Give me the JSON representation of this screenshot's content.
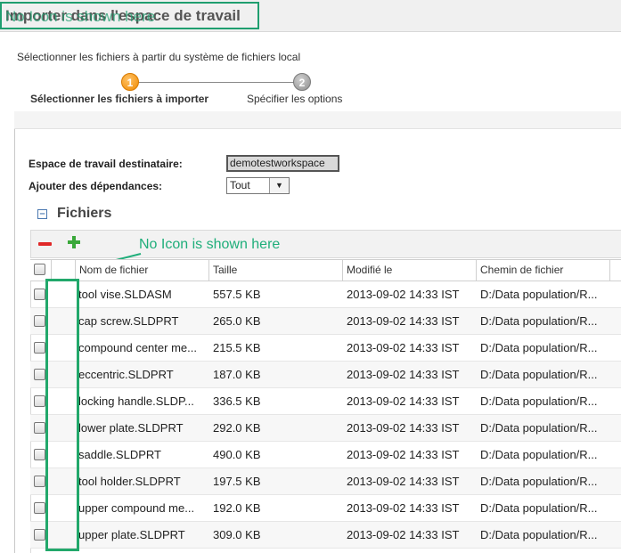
{
  "window": {
    "title": "Importer dans l'espace de travail",
    "title_overlay": "No Icon is shown here"
  },
  "instruction": "Sélectionner les fichiers à partir du système de fichiers local",
  "wizard": {
    "steps": [
      {
        "number": "1",
        "label": "Sélectionner les fichiers à importer",
        "active": true
      },
      {
        "number": "2",
        "label": "Spécifier les options",
        "active": false
      }
    ]
  },
  "form": {
    "workspace_label": "Espace de travail destinataire:",
    "workspace_value": "demotestworkspace",
    "dependencies_label": "Ajouter des dépendances:",
    "dependencies_value": "Tout"
  },
  "files_section": {
    "title": "Fichiers",
    "annotation": "No Icon is shown here",
    "columns": [
      "Nom de fichier",
      "Taille",
      "Modifié le",
      "Chemin de fichier"
    ],
    "rows": [
      {
        "name": "tool vise.SLDASM",
        "size": "557.5 KB",
        "modified": "2013-09-02 14:33 IST",
        "path": "D:/Data population/R..."
      },
      {
        "name": "cap screw.SLDPRT",
        "size": "265.0 KB",
        "modified": "2013-09-02 14:33 IST",
        "path": "D:/Data population/R..."
      },
      {
        "name": "compound center me...",
        "size": "215.5 KB",
        "modified": "2013-09-02 14:33 IST",
        "path": "D:/Data population/R..."
      },
      {
        "name": "eccentric.SLDPRT",
        "size": "187.0 KB",
        "modified": "2013-09-02 14:33 IST",
        "path": "D:/Data population/R..."
      },
      {
        "name": "locking handle.SLDP...",
        "size": "336.5 KB",
        "modified": "2013-09-02 14:33 IST",
        "path": "D:/Data population/R..."
      },
      {
        "name": "lower plate.SLDPRT",
        "size": "292.0 KB",
        "modified": "2013-09-02 14:33 IST",
        "path": "D:/Data population/R..."
      },
      {
        "name": "saddle.SLDPRT",
        "size": "490.0 KB",
        "modified": "2013-09-02 14:33 IST",
        "path": "D:/Data population/R..."
      },
      {
        "name": "tool holder.SLDPRT",
        "size": "197.5 KB",
        "modified": "2013-09-02 14:33 IST",
        "path": "D:/Data population/R..."
      },
      {
        "name": "upper compound me...",
        "size": "192.0 KB",
        "modified": "2013-09-02 14:33 IST",
        "path": "D:/Data population/R..."
      },
      {
        "name": "upper plate.SLDPRT",
        "size": "309.0 KB",
        "modified": "2013-09-02 14:33 IST",
        "path": "D:/Data population/R..."
      }
    ]
  },
  "colors": {
    "annotation_green": "#1fae7a",
    "step_active": "#f08a00",
    "step_inactive": "#8e8e8e",
    "remove_red": "#e02828",
    "add_green": "#3aa83a"
  },
  "icons": {
    "remove": "minus-icon",
    "add": "plus-icon",
    "collapse": "collapse-icon",
    "dropdown": "chevron-down-icon"
  }
}
